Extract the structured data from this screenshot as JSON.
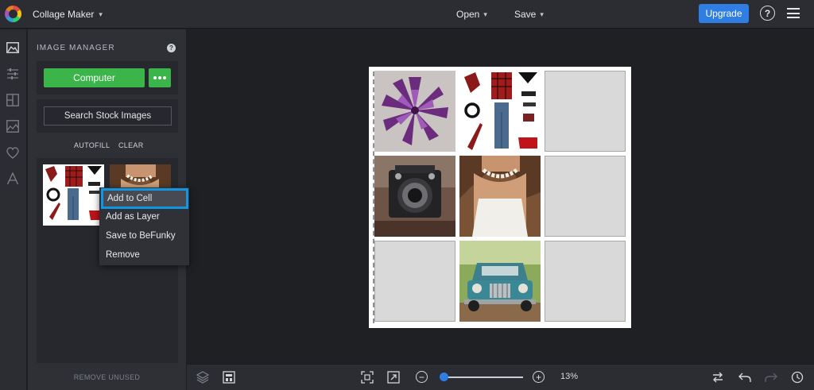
{
  "header": {
    "app_menu_label": "Collage Maker",
    "open_label": "Open",
    "save_label": "Save",
    "upgrade_label": "Upgrade",
    "help_glyph": "?"
  },
  "rail": {
    "icons": [
      "image-icon",
      "sliders-icon",
      "layout-icon",
      "photo-icon",
      "heart-icon",
      "text-icon"
    ]
  },
  "panel": {
    "title": "IMAGE MANAGER",
    "help_glyph": "?",
    "computer_label": "Computer",
    "stock_label": "Search Stock Images",
    "autofill_label": "AUTOFILL",
    "clear_label": "CLEAR",
    "remove_unused_label": "REMOVE UNUSED"
  },
  "context_menu": {
    "items": [
      "Add to Cell",
      "Add as Layer",
      "Save to BeFunky",
      "Remove"
    ]
  },
  "bottom": {
    "zoom_label": "13%",
    "zoom_minus": "−",
    "zoom_plus": "+",
    "zoom_level": 0.13
  },
  "colors": {
    "accent_blue": "#2f7ee3",
    "green": "#3bb54a",
    "highlight": "#1396e0"
  }
}
